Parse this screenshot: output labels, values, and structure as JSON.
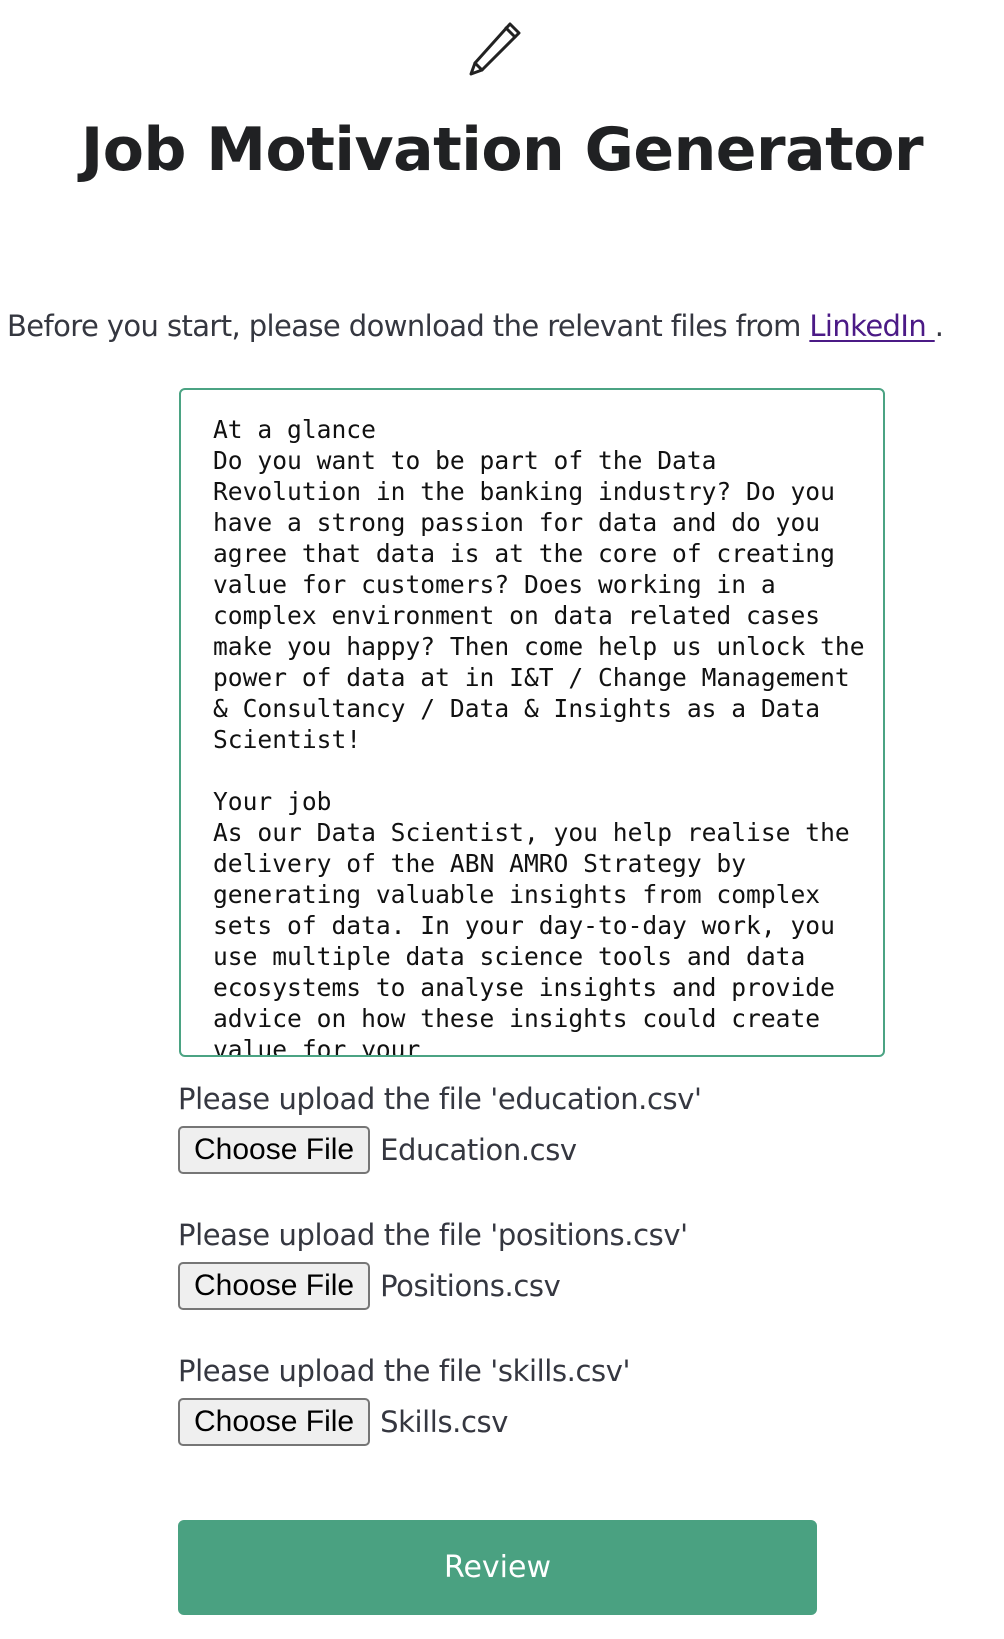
{
  "header": {
    "icon": "pencil-icon",
    "title": "Job Motivation Generator"
  },
  "intro": {
    "text": "Before you start, please download the relevant files from ",
    "link_label": "LinkedIn ",
    "suffix": "."
  },
  "job_description": {
    "value": "At a glance\nDo you want to be part of the Data Revolution in the banking industry? Do you have a strong passion for data and do you agree that data is at the core of creating value for customers? Does working in a complex environment on data related cases make you happy? Then come help us unlock the power of data at in I&T / Change Management & Consultancy / Data & Insights as a Data Scientist!\n\nYour job\nAs our Data Scientist, you help realise the delivery of the ABN AMRO Strategy by generating valuable insights from complex sets of data. In your day-to-day work, you use multiple data science tools and data ecosystems to analyse insights and provide advice on how these insights could create value for your"
  },
  "uploads": [
    {
      "label": "Please upload the file 'education.csv'",
      "button_label": "Choose File",
      "file_name": "Education.csv"
    },
    {
      "label": "Please upload the file 'positions.csv'",
      "button_label": "Choose File",
      "file_name": "Positions.csv"
    },
    {
      "label": "Please upload the file 'skills.csv'",
      "button_label": "Choose File",
      "file_name": "Skills.csv"
    }
  ],
  "actions": {
    "review_label": "Review"
  },
  "colors": {
    "accent": "#4aa181",
    "textarea_border": "#4ba383",
    "link": "#4b1a86",
    "title": "#202123"
  }
}
